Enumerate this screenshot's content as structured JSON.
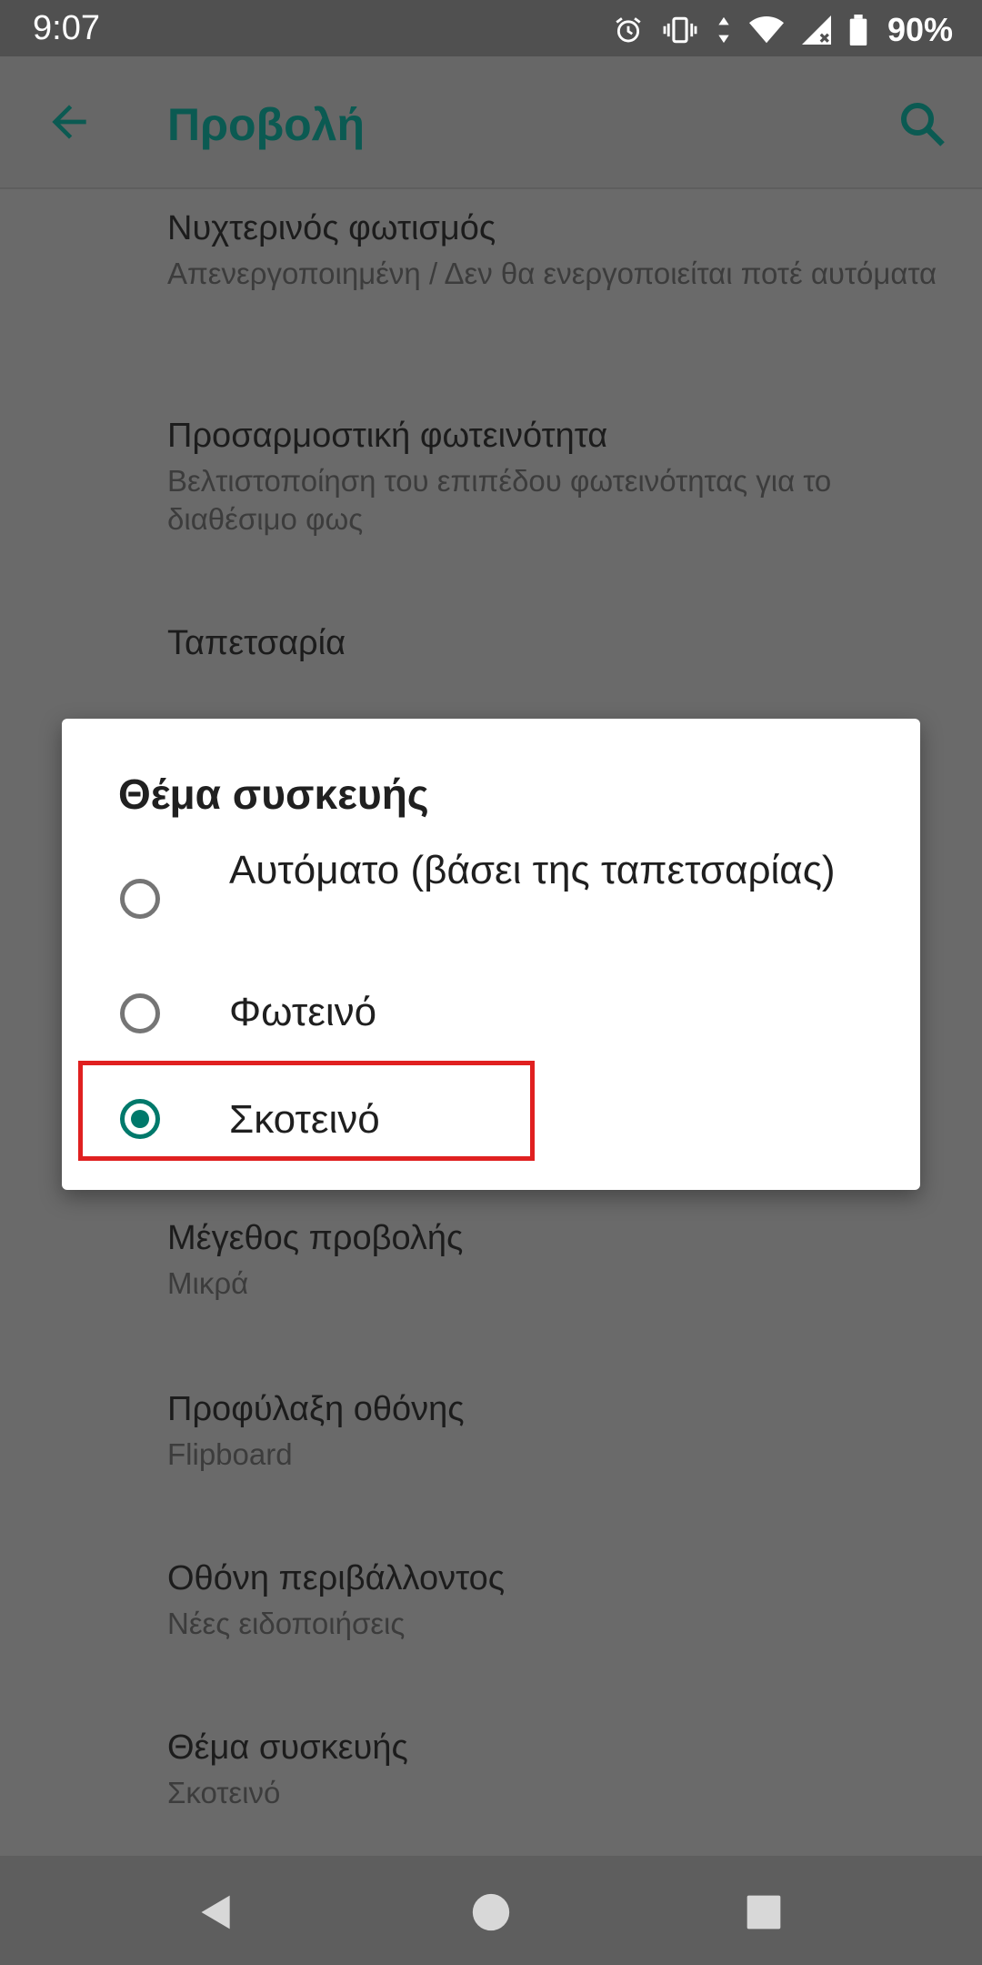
{
  "status_bar": {
    "time": "9:07",
    "battery": "90%",
    "icons": [
      "alarm-icon",
      "vibrate-icon",
      "data-arrows-icon",
      "wifi-icon",
      "signal-icon",
      "battery-icon"
    ]
  },
  "app_bar": {
    "title": "Προβολή",
    "back_icon": "arrow-back-icon",
    "search_icon": "search-icon",
    "accent_color": "#0b5a52"
  },
  "settings": [
    {
      "title": "Νυχτερινός φωτισμός",
      "summary": "Απενεργοποιημένη / Δεν θα ενεργοποιείται ποτέ αυτόματα"
    },
    {
      "title": "Προσαρμοστική φωτεινότητα",
      "summary": "Βελτιστοποίηση του επιπέδου φωτεινότητας για το διαθέσιμο φως"
    },
    {
      "title": "Ταπετσαρία",
      "summary": ""
    },
    {
      "title": "Μέγεθος προβολής",
      "summary": "Μικρά"
    },
    {
      "title": "Προφύλαξη οθόνης",
      "summary": "Flipboard"
    },
    {
      "title": "Οθόνη περιβάλλοντος",
      "summary": "Νέες ειδοποιήσεις"
    },
    {
      "title": "Θέμα συσκευής",
      "summary": "Σκοτεινό"
    }
  ],
  "dialog": {
    "title": "Θέμα συσκευής",
    "options": [
      {
        "label": "Αυτόματο (βάσει της ταπετσαρίας)",
        "selected": false
      },
      {
        "label": "Φωτεινό",
        "selected": false
      },
      {
        "label": "Σκοτεινό",
        "selected": true
      }
    ],
    "radio_color": "#00796b",
    "highlight_color": "#e02020"
  },
  "nav_bar": {
    "buttons": [
      "back-triangle-icon",
      "home-circle-icon",
      "recents-square-icon"
    ]
  }
}
